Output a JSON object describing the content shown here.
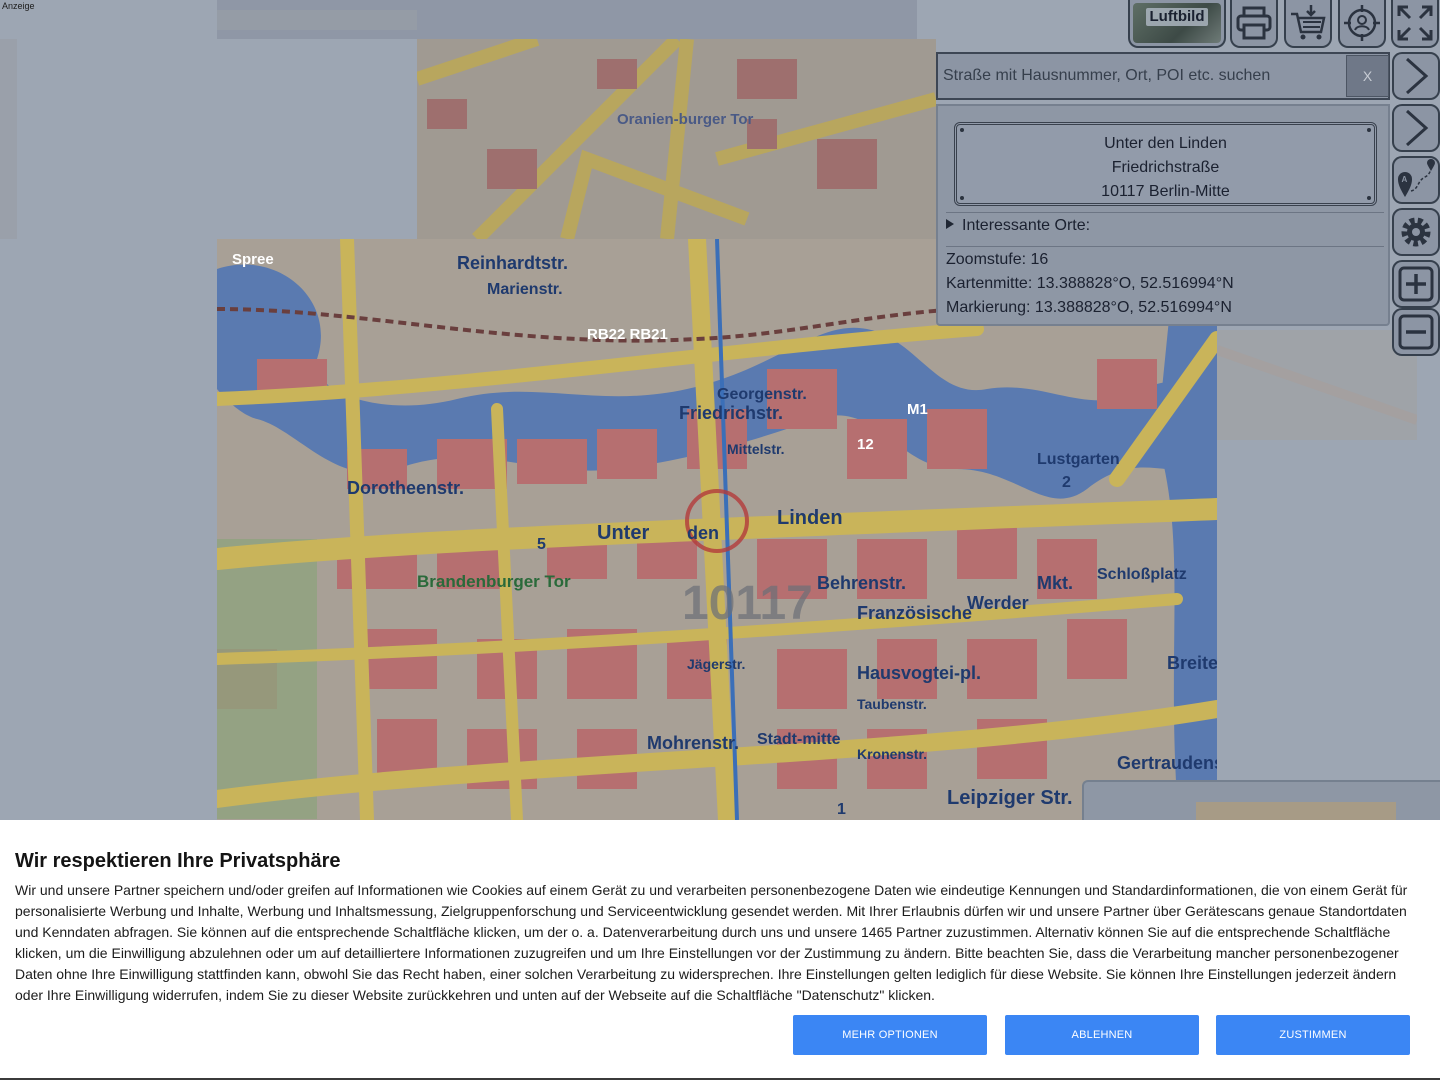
{
  "ad_label": "Anzeige",
  "toolbar": {
    "aerial_label": "Luftbild",
    "print_icon": "printer-icon",
    "cart_icon": "cart-download-icon",
    "locate_icon": "locate-me-icon",
    "fullscreen_icon": "fullscreen-icon"
  },
  "search": {
    "placeholder": "Straße mit Hausnummer, Ort, POI etc. suchen",
    "value": "",
    "clear_label": "X"
  },
  "info_panel": {
    "address_lines": [
      "Unter den Linden",
      "Friedrichstraße",
      "10117 Berlin-Mitte"
    ],
    "poi_label": "Interessante Orte:",
    "zoom_text": "Zoomstufe: 16",
    "center_text": "Kartenmitte: 13.388828°O, 52.516994°N",
    "marker_text": "Markierung: 13.388828°O, 52.516994°N"
  },
  "map_labels": [
    "Friedrichstr.",
    "Unter",
    "den",
    "Linden",
    "Behrenstr.",
    "Französische",
    "Werder",
    "Mkt.",
    "Leipziger Str.",
    "Brandenburger Tor",
    "Dorotheenstr.",
    "Oranien-burger Tor",
    "Hausvogtei-pl.",
    "Mohrenstr.",
    "Lustgarten",
    "Schloßplatz",
    "Gertraudenstr.",
    "Breite Str.",
    "Stadt-mitte",
    "Reinhardtstr.",
    "Marienstr.",
    "Georgenstr.",
    "Mittelstr.",
    "Taubenstr.",
    "Kronenstr.",
    "Jägerstr.",
    "10117",
    "RB22 RB21",
    "M1",
    "12",
    "5",
    "2",
    "1",
    "Spree"
  ],
  "colors": {
    "overlay": "#8f97a6",
    "accent_button": "#3b86f4",
    "map_road_yellow": "#f2d24a",
    "map_block_red": "#c86b6e",
    "map_water_blue": "#3f7fd6"
  },
  "consent": {
    "title": "Wir respektieren Ihre Privatsphäre",
    "text": "Wir und unsere Partner speichern und/oder greifen auf Informationen wie Cookies auf einem Gerät zu und verarbeiten personenbezogene Daten wie eindeutige Kennungen und Standardinformationen, die von einem Gerät für personalisierte Werbung und Inhalte, Werbung und Inhaltsmessung, Zielgruppenforschung und Serviceentwicklung gesendet werden. Mit Ihrer Erlaubnis dürfen wir und unsere Partner über Gerätescans genaue Standortdaten und Kenndaten abfragen. Sie können auf die entsprechende Schaltfläche klicken, um der o. a. Datenverarbeitung durch uns und unsere 1465 Partner zuzustimmen. Alternativ können Sie auf die entsprechende Schaltfläche klicken, um die Einwilligung abzulehnen oder um auf detailliertere Informationen zuzugreifen und um Ihre Einstellungen vor der Zustimmung zu ändern. Bitte beachten Sie, dass die Verarbeitung mancher personenbezogener Daten ohne Ihre Einwilligung stattfinden kann, obwohl Sie das Recht haben, einer solchen Verarbeitung zu widersprechen. Ihre Einstellungen gelten lediglich für diese Website. Sie können Ihre Einstellungen jederzeit ändern oder Ihre Einwilligung widerrufen, indem Sie zu dieser Website zurückkehren und unten auf der Webseite auf die Schaltfläche \"Datenschutz\" klicken.",
    "more_label": "MEHR OPTIONEN",
    "reject_label": "ABLEHNEN",
    "accept_label": "ZUSTIMMEN"
  }
}
